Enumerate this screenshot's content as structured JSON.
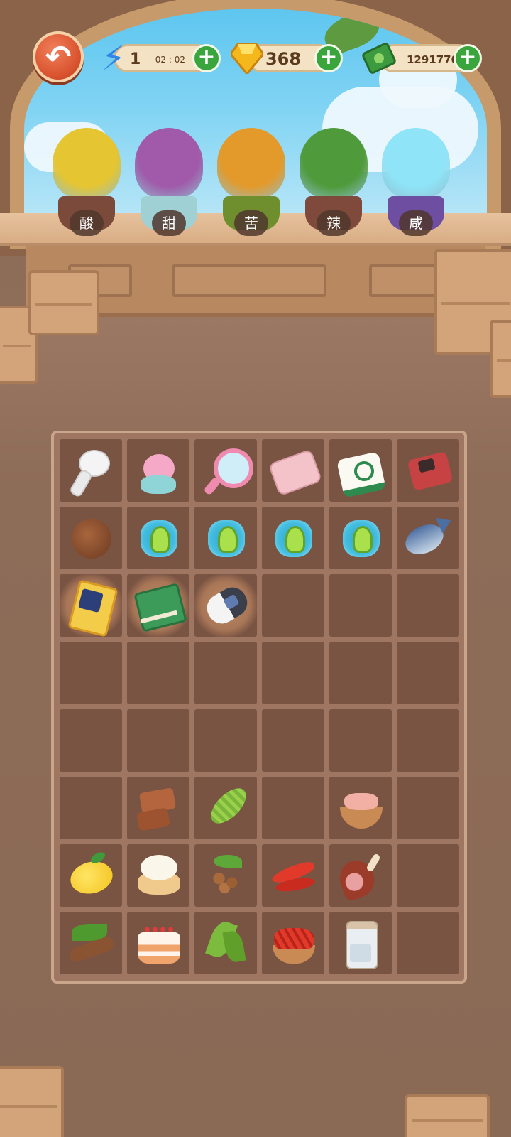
{
  "topbar": {
    "back_icon": "back-arrow-icon",
    "energy": {
      "icon": "lightning-icon",
      "value": "1",
      "timer": "02 : 02",
      "plus": "+"
    },
    "gems": {
      "icon": "gem-icon",
      "value": "368",
      "plus": "+"
    },
    "cash": {
      "icon": "cash-icon",
      "value": "1291770",
      "plus": "+"
    }
  },
  "plants": [
    {
      "label": "酸",
      "icon": "lemon-tree-icon",
      "pot_color": "#7b4a3a",
      "foliage_color": "#e5c532"
    },
    {
      "label": "甜",
      "icon": "sugarcane-icon",
      "pot_color": "#9fd0d4",
      "foliage_color": "#a05aa9"
    },
    {
      "label": "苦",
      "icon": "golden-vine-icon",
      "pot_color": "#6f8f2f",
      "foliage_color": "#e39a2a"
    },
    {
      "label": "辣",
      "icon": "chili-plant-icon",
      "pot_color": "#7f4a3b",
      "foliage_color": "#4f9a3a"
    },
    {
      "label": "咸",
      "icon": "salt-crystal-icon",
      "pot_color": "#6d4ea1",
      "foliage_color": "#8fe4f7"
    }
  ],
  "inventory": {
    "columns": 6,
    "rows": 8,
    "items": [
      [
        "earbud",
        "bunny-plush",
        "hand-mirror",
        "pink-wallet",
        "mahjong-tile",
        "handheld-console"
      ],
      [
        "walnut",
        "seed-bud",
        "seed-bud",
        "seed-bud",
        "seed-bud",
        "fish"
      ],
      [
        "collector-card",
        "recipe-notebook",
        "car-key",
        "",
        "",
        ""
      ],
      [
        "",
        "",
        "",
        "",
        "",
        ""
      ],
      [
        "",
        "",
        "",
        "",
        "",
        ""
      ],
      [
        "",
        "fudge",
        "bitter-melon",
        "",
        "meat-bowl",
        ""
      ],
      [
        "lemon",
        "cream-puff",
        "coffee-beans",
        "red-chili",
        "ham-leg",
        ""
      ],
      [
        "tamarind",
        "strawberry-cake",
        "tea-leaves",
        "chili-bowl",
        "salt-jar",
        ""
      ]
    ],
    "highlighted": [
      "collector-card",
      "recipe-notebook",
      "car-key"
    ]
  },
  "colors": {
    "accent_green": "#3aa53c",
    "back_button": "#d9532f",
    "sky": "#5ec6ef"
  }
}
